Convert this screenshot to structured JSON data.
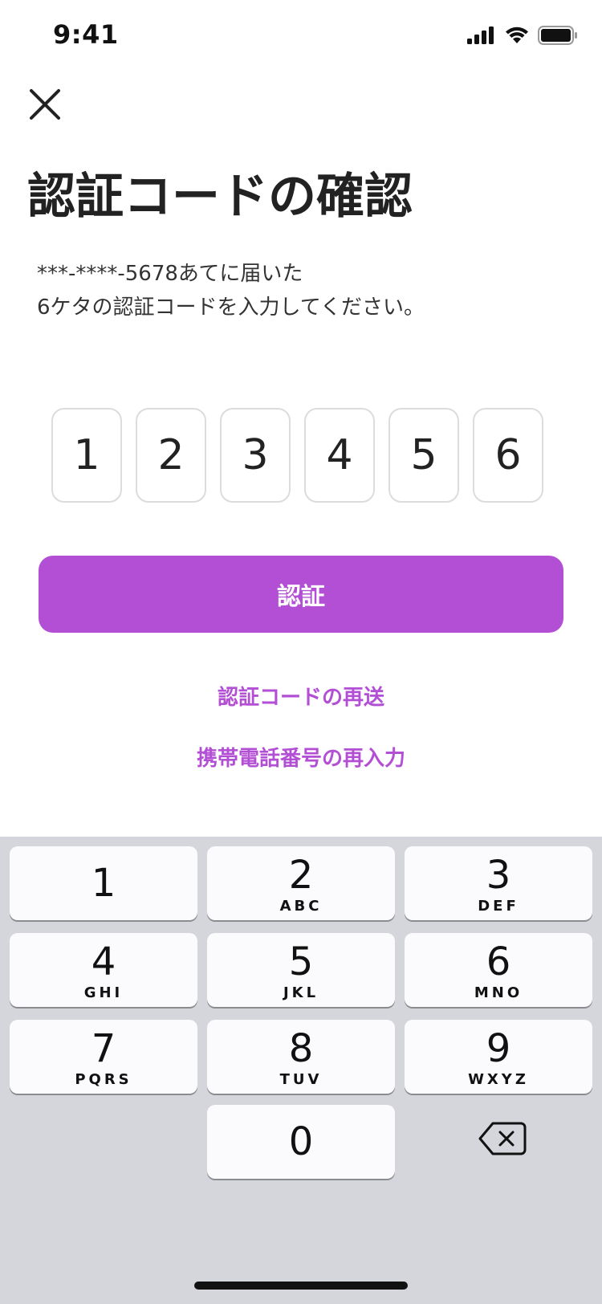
{
  "status_bar": {
    "time": "9:41",
    "icons": [
      "signal-icon",
      "wifi-icon",
      "battery-icon"
    ]
  },
  "header": {
    "close_icon": "close-icon",
    "title": "認証コードの確認"
  },
  "description": {
    "line1": "***-****-5678あてに届いた",
    "line2": "6ケタの認証コードを入力してください。"
  },
  "code_digits": [
    "1",
    "2",
    "3",
    "4",
    "5",
    "6"
  ],
  "actions": {
    "verify_label": "認証",
    "resend_label": "認証コードの再送",
    "reenter_label": "携帯電話番号の再入力"
  },
  "keyboard": {
    "keys": [
      {
        "digit": "1",
        "letters": ""
      },
      {
        "digit": "2",
        "letters": "ABC"
      },
      {
        "digit": "3",
        "letters": "DEF"
      },
      {
        "digit": "4",
        "letters": "GHI"
      },
      {
        "digit": "5",
        "letters": "JKL"
      },
      {
        "digit": "6",
        "letters": "MNO"
      },
      {
        "digit": "7",
        "letters": "PQRS"
      },
      {
        "digit": "8",
        "letters": "TUV"
      },
      {
        "digit": "9",
        "letters": "WXYZ"
      },
      {
        "digit": "0",
        "letters": ""
      }
    ],
    "delete_icon": "backspace-icon"
  },
  "colors": {
    "accent": "#b34fd5",
    "keyboard_bg": "#d5d6db",
    "key_bg": "#fbfbfd"
  }
}
